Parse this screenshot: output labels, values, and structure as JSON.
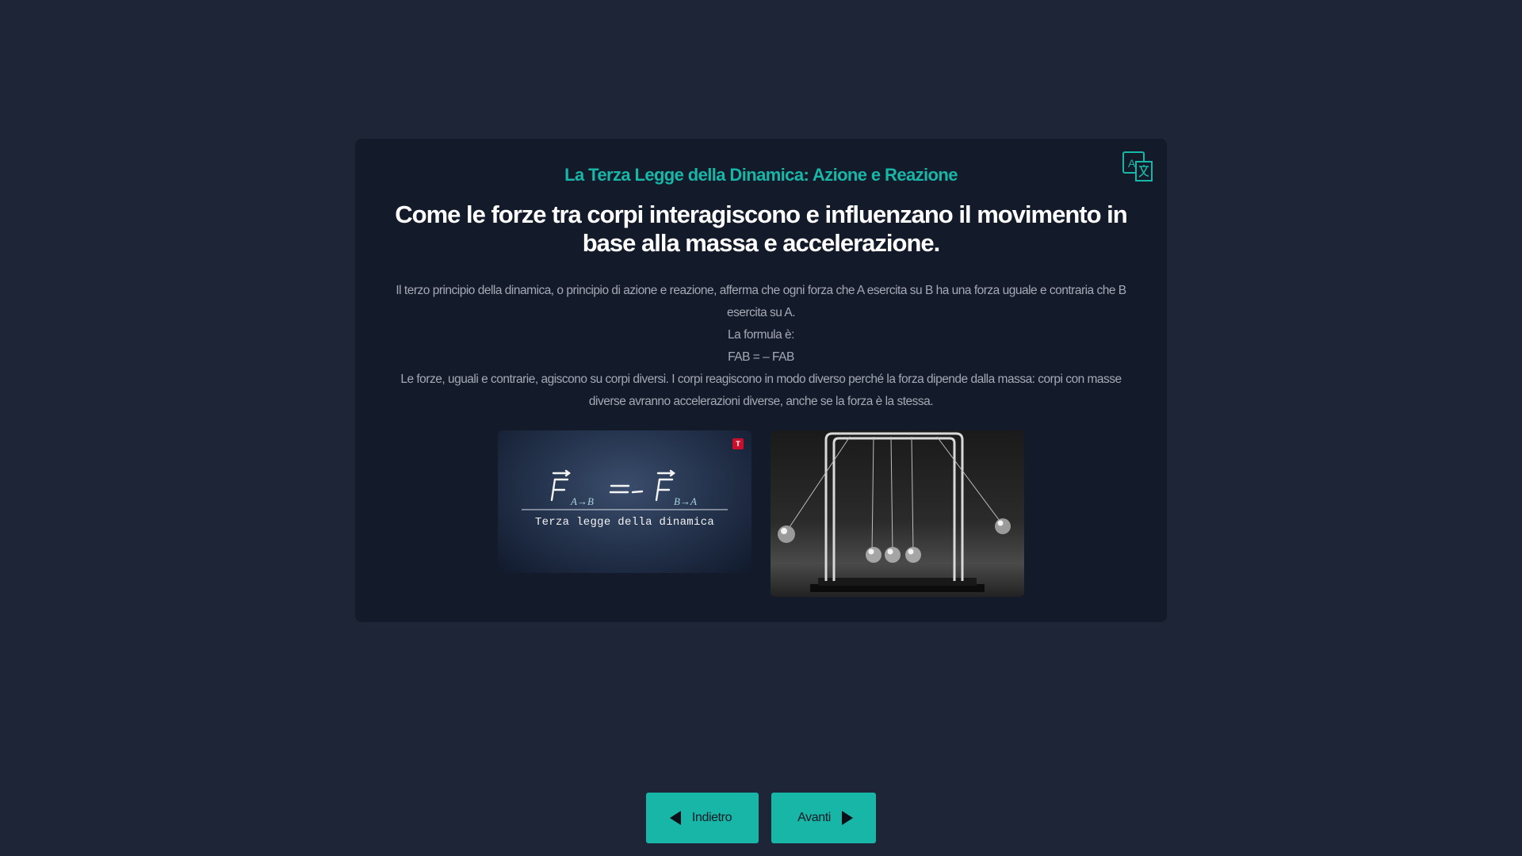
{
  "slide": {
    "kicker": "La Terza Legge della Dinamica: Azione e Reazione",
    "title": "Come le forze tra corpi interagiscono e influenzano il movimento in base alla massa e accelerazione.",
    "paragraphs": [
      "Il terzo principio della dinamica, o principio di azione e reazione, afferma che ogni forza che A esercita su B ha una forza uguale e contraria che B esercita su A.",
      "La formula è:",
      "FAB = – FAB",
      "Le forze, uguali e contrarie, agiscono su corpi diversi. I corpi reagiscono in modo diverso perché la forza dipende dalla massa: corpi con masse diverse avranno accelerazioni diverse, anche se la forza è la stessa."
    ],
    "images": {
      "formula": {
        "badge": "T",
        "caption": "Terza legge della dinamica"
      },
      "cradle": {}
    },
    "translate_icon": "translate-icon"
  },
  "nav": {
    "back_label": "Indietro",
    "next_label": "Avanti"
  },
  "colors": {
    "accent": "#17b6a7",
    "background": "#1e2536",
    "card": "#131a29"
  }
}
